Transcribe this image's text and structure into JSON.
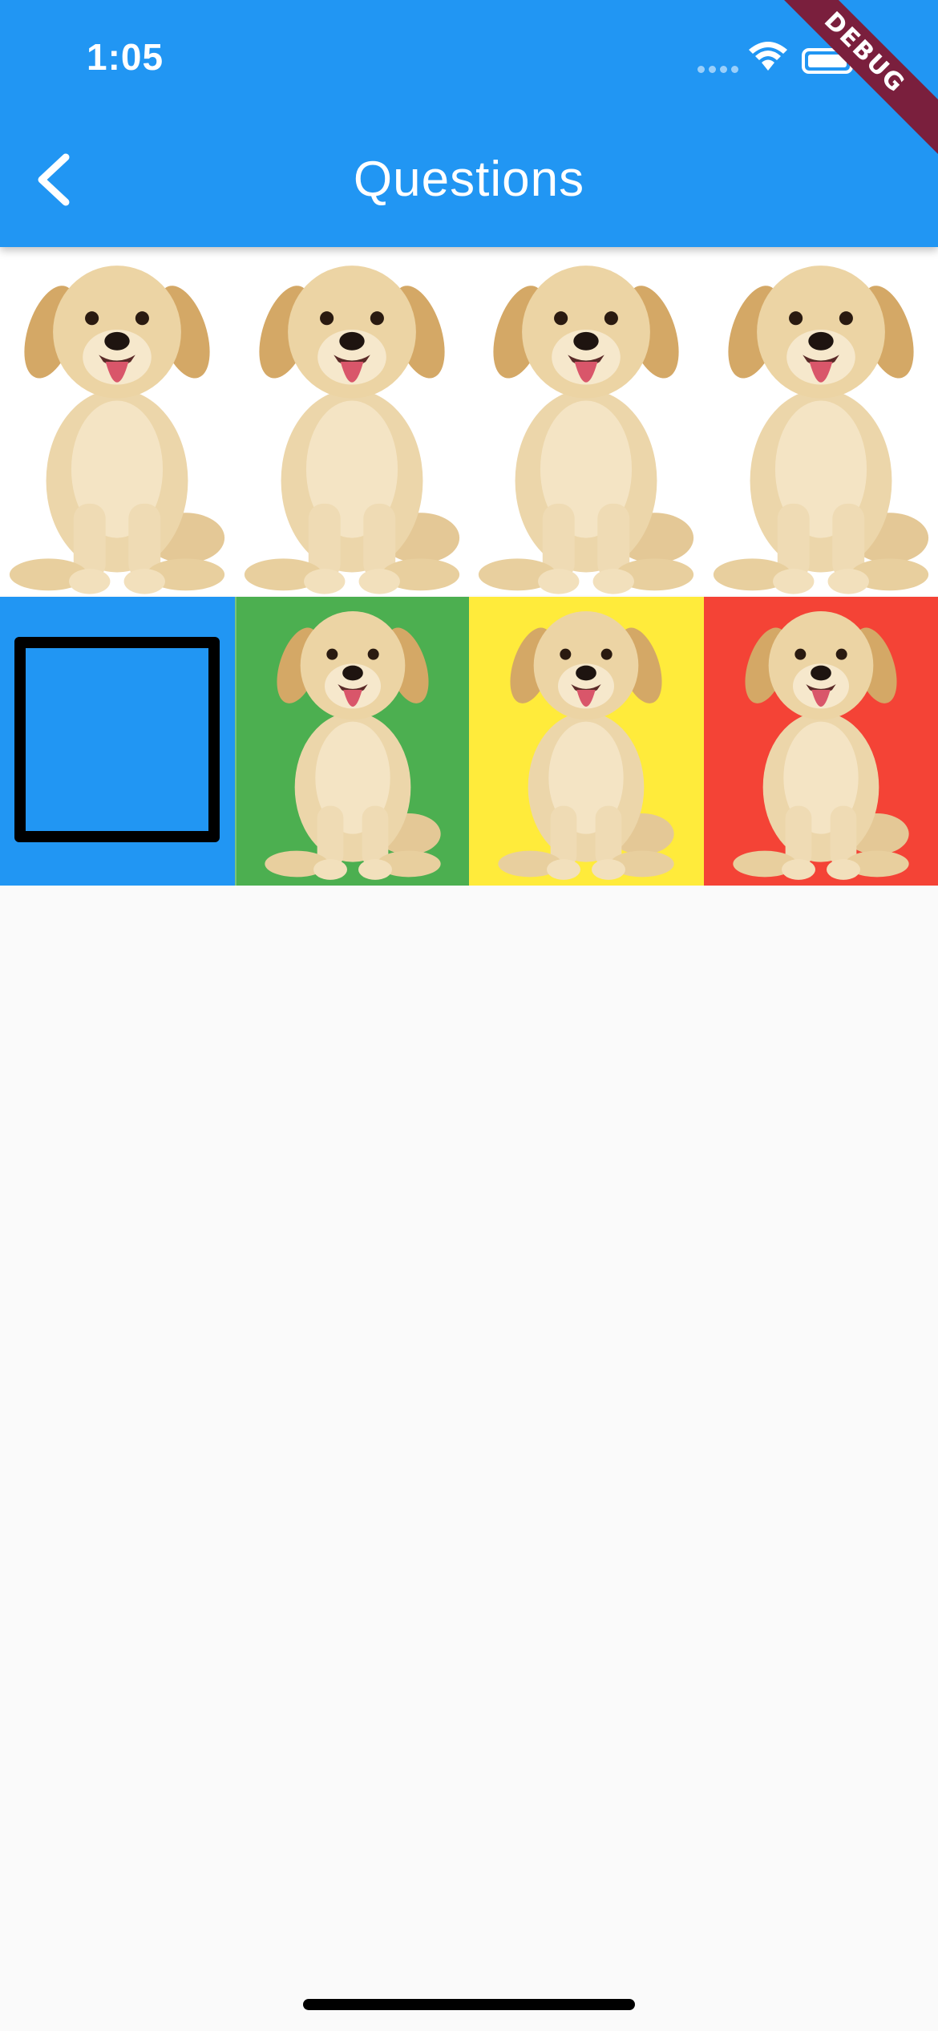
{
  "status_bar": {
    "time": "1:05"
  },
  "app_bar": {
    "title": "Questions"
  },
  "debug_banner": {
    "label": "DEBUG"
  },
  "colors": {
    "primary": "#2196f3",
    "green": "#4caf50",
    "yellow": "#ffeb3b",
    "red": "#f44336",
    "background": "#fafafa"
  },
  "top_row": [
    {
      "icon": "dog-icon"
    },
    {
      "icon": "dog-icon"
    },
    {
      "icon": "dog-icon"
    },
    {
      "icon": "dog-icon"
    }
  ],
  "bottom_row": [
    {
      "color": "#2196f3",
      "content": "empty-drop-target"
    },
    {
      "color": "#4caf50",
      "icon": "dog-icon"
    },
    {
      "color": "#ffeb3b",
      "icon": "dog-icon"
    },
    {
      "color": "#f44336",
      "icon": "dog-icon"
    }
  ]
}
